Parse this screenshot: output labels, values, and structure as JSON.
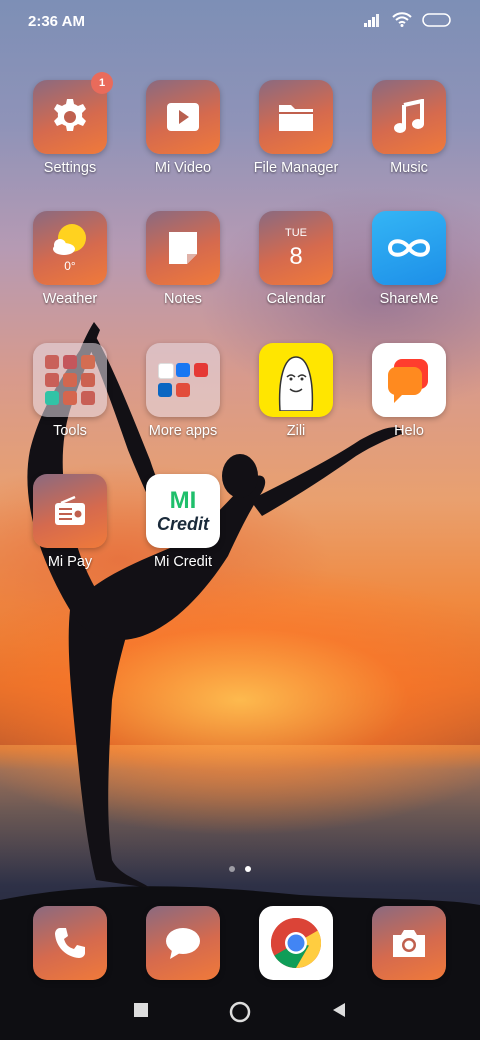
{
  "status": {
    "time": "2:36 AM"
  },
  "apps": [
    {
      "label": "Settings",
      "icon": "gear-icon",
      "badge": "1"
    },
    {
      "label": "Mi Video",
      "icon": "play-icon"
    },
    {
      "label": "File Manager",
      "icon": "folder-icon"
    },
    {
      "label": "Music",
      "icon": "music-note-icon"
    },
    {
      "label": "Weather",
      "icon": "weather-icon",
      "sub": "0°"
    },
    {
      "label": "Notes",
      "icon": "note-icon"
    },
    {
      "label": "Calendar",
      "icon": "calendar-icon",
      "day": "TUE",
      "date": "8"
    },
    {
      "label": "ShareMe",
      "icon": "infinity-icon"
    },
    {
      "label": "Tools",
      "icon": "tools-folder-icon"
    },
    {
      "label": "More apps",
      "icon": "more-apps-folder-icon"
    },
    {
      "label": "Zili",
      "icon": "zili-face-icon"
    },
    {
      "label": "Helo",
      "icon": "helo-chat-icon"
    },
    {
      "label": "Mi Pay",
      "icon": "radio-icon"
    },
    {
      "label": "Mi Credit",
      "icon": "mi-credit-logo",
      "logo_text_top": "MI",
      "logo_text_bottom": "Credit"
    }
  ],
  "dock": [
    {
      "icon": "phone-icon"
    },
    {
      "icon": "messages-icon"
    },
    {
      "icon": "chrome-icon"
    },
    {
      "icon": "camera-icon"
    }
  ],
  "pager": {
    "pages": 2,
    "active": 2
  },
  "nav": [
    "recents-button",
    "home-button",
    "back-button"
  ]
}
